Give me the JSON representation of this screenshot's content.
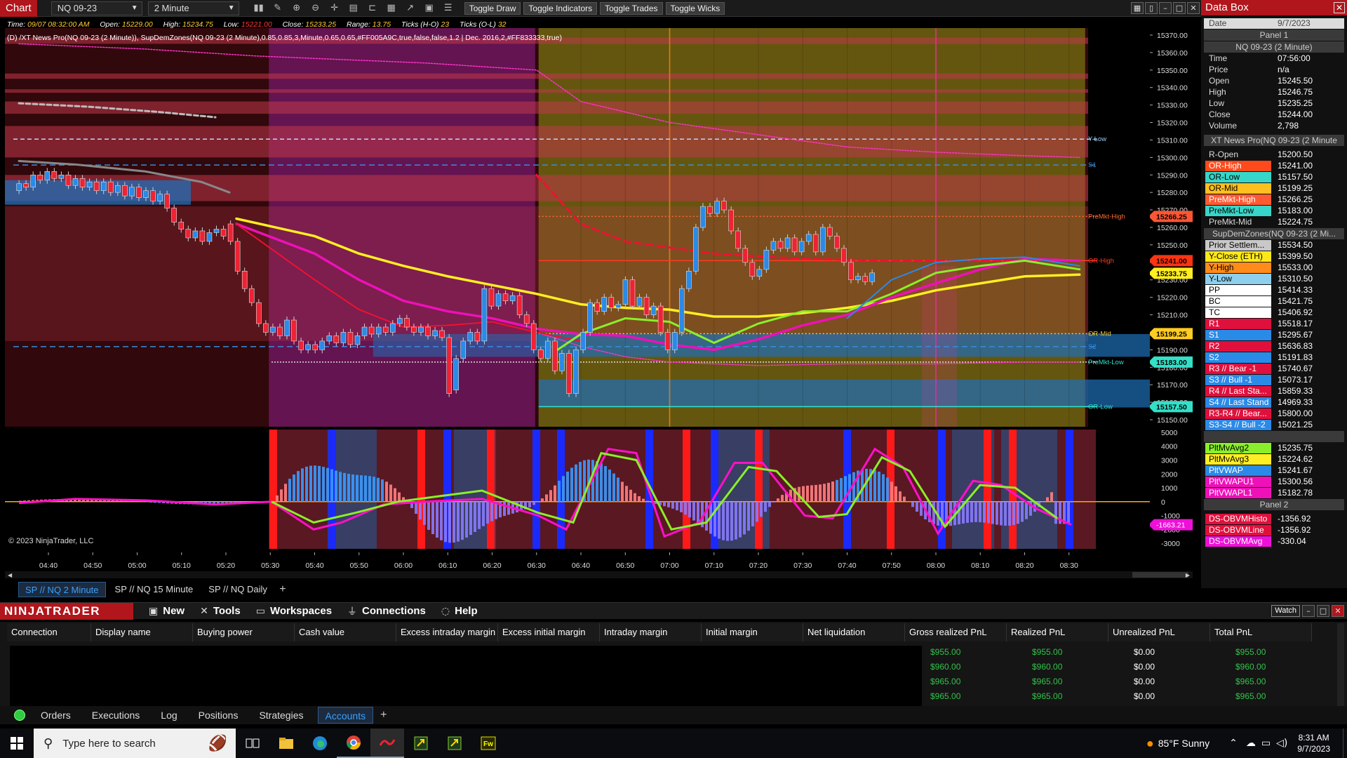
{
  "chart_window": {
    "title": "Chart",
    "instrument": "NQ 09-23",
    "interval": "2 Minute",
    "toolbar_buttons": [
      "Toggle Draw",
      "Toggle Indicators",
      "Toggle Trades",
      "Toggle Wicks"
    ],
    "toolbar_icons": [
      "bars-icon",
      "pencil-icon",
      "zoom-in-icon",
      "zoom-out-icon",
      "crosshair-icon",
      "properties-icon",
      "templates-icon",
      "instrument-overlay-icon",
      "strategy-icon",
      "data-box-icon",
      "list-icon"
    ]
  },
  "ohlc_info": {
    "time_label": "Time:",
    "time": "09/07 08:32:00 AM",
    "open_label": "Open:",
    "open": "15229.00",
    "high_label": "High:",
    "high": "15234.75",
    "low_label": "Low:",
    "low": "15221.00",
    "close_label": "Close:",
    "close": "15233.25",
    "range_label": "Range:",
    "range": "13.75",
    "ticks_ho_label": "Ticks (H-O)",
    "ticks_ho": "23",
    "ticks_ol_label": "Ticks (O-L)",
    "ticks_ol": "32"
  },
  "indicator_line": "(D) /XT News Pro(NQ 09-23 (2 Minute)), SupDemZones(NQ 09-23 (2 Minute),0.85,0.85,3,Minute,0.65,0.65,#FF005A9C,true,false,false,1.2 | Dec. 2016,2,#FF833333,true)",
  "price_axis": {
    "ticks": [
      "15370.00",
      "15360.00",
      "15350.00",
      "15340.00",
      "15330.00",
      "15320.00",
      "15310.00",
      "15300.00",
      "15290.00",
      "15280.00",
      "15270.00",
      "15260.00",
      "15250.00",
      "15240.00",
      "15230.00",
      "15220.00",
      "15210.00",
      "15200.00",
      "15190.00",
      "15180.00",
      "15170.00",
      "15160.00",
      "15150.00"
    ],
    "range": [
      15146,
      15374
    ]
  },
  "price_markers": [
    {
      "value": "15266.25",
      "price": 15266.25,
      "color": "#ff5533"
    },
    {
      "value": "15241.00",
      "price": 15241.0,
      "color": "#ff3311"
    },
    {
      "value": "15233.75",
      "price": 15233.75,
      "color": "#ffee22"
    },
    {
      "value": "15199.25",
      "price": 15199.25,
      "color": "#ffcc22"
    },
    {
      "value": "15183.00",
      "price": 15183.0,
      "color": "#33e0c8"
    },
    {
      "value": "15157.50",
      "price": 15157.5,
      "color": "#33e0c8"
    }
  ],
  "level_labels": [
    {
      "text": "Y-Low",
      "price": 15310.5,
      "color": "#99ccee"
    },
    {
      "text": "S1",
      "price": 15295.67,
      "color": "#3a8adc"
    },
    {
      "text": "PreMkt-High",
      "price": 15266.25,
      "color": "#ff6a33"
    },
    {
      "text": "OR-High",
      "price": 15241.0,
      "color": "#ff3b22"
    },
    {
      "text": "OR-Mid",
      "price": 15199.25,
      "color": "#ffcc33"
    },
    {
      "text": "S2",
      "price": 15191.83,
      "color": "#3a8adc"
    },
    {
      "text": "PreMkt-Low",
      "price": 15183.0,
      "color": "#33e0c8"
    },
    {
      "text": "OR-Low",
      "price": 15157.5,
      "color": "#33e0c8"
    }
  ],
  "osc_axis": {
    "ticks": [
      "5000",
      "4000",
      "3000",
      "2000",
      "1000",
      "0",
      "-1000",
      "-2000",
      "-3000"
    ],
    "range": [
      -3400,
      5200
    ],
    "marker": "-1663.21",
    "marker_value": -1663.21
  },
  "time_axis": [
    "04:40",
    "04:50",
    "05:00",
    "05:10",
    "05:20",
    "05:30",
    "05:40",
    "05:50",
    "06:00",
    "06:10",
    "06:20",
    "06:30",
    "06:40",
    "06:50",
    "07:00",
    "07:10",
    "07:20",
    "07:30",
    "07:40",
    "07:50",
    "08:00",
    "08:10",
    "08:20",
    "08:30"
  ],
  "copyright": "© 2023 NinjaTrader, LLC",
  "chart_tabs": [
    {
      "label": "SP // NQ  2 Minute",
      "active": true
    },
    {
      "label": "SP // NQ  15 Minute",
      "active": false
    },
    {
      "label": "SP // NQ  Daily",
      "active": false
    }
  ],
  "data_box": {
    "title": "Data Box",
    "rows": [
      {
        "label": "Date",
        "value": "9/7/2023",
        "bg": "#dcdcdc",
        "fg": "#444",
        "kind": "header"
      },
      {
        "label": "Panel 1",
        "kind": "sep"
      },
      {
        "label": "NQ 09-23 (2 Minute)",
        "kind": "sep"
      },
      {
        "label": "Time",
        "value": "07:56:00"
      },
      {
        "label": "Price",
        "value": "n/a"
      },
      {
        "label": "Open",
        "value": "15245.50"
      },
      {
        "label": "High",
        "value": "15246.75"
      },
      {
        "label": "Low",
        "value": "15235.25"
      },
      {
        "label": "Close",
        "value": "15244.00"
      },
      {
        "label": "Volume",
        "value": "2,798"
      },
      {
        "kind": "gap"
      },
      {
        "label": "XT News Pro(NQ 09-23 (2 Minute",
        "kind": "sep"
      },
      {
        "kind": "gap"
      },
      {
        "label": "R-Open",
        "value": "15200.50"
      },
      {
        "label": "OR-High",
        "value": "15241.00",
        "bg": "#ff4a1c",
        "fg": "#fff"
      },
      {
        "label": "OR-Low",
        "value": "15157.50",
        "bg": "#38d6c8",
        "fg": "#000"
      },
      {
        "label": "OR-Mid",
        "value": "15199.25",
        "bg": "#ffbf1f",
        "fg": "#000"
      },
      {
        "label": "PreMkt-High",
        "value": "15266.25",
        "bg": "#ff5a33",
        "fg": "#fff"
      },
      {
        "label": "PreMkt-Low",
        "value": "15183.00",
        "bg": "#38d6c8",
        "fg": "#000"
      },
      {
        "label": "PreMkt-Mid",
        "value": "15224.75"
      },
      {
        "label": "SupDemZones(NQ 09-23 (2 Mi...",
        "kind": "sep"
      },
      {
        "label": "Prior Settlem...",
        "value": "15534.50",
        "bg": "#c8c8c8",
        "fg": "#000"
      },
      {
        "label": "Y-Close (ETH)",
        "value": "15399.50",
        "bg": "#ffe81a",
        "fg": "#000"
      },
      {
        "label": "Y-High",
        "value": "15533.00",
        "bg": "#ff8c1a",
        "fg": "#000"
      },
      {
        "label": "Y-Low",
        "value": "15310.50",
        "bg": "#8ecfee",
        "fg": "#000"
      },
      {
        "label": "PP",
        "value": "15414.33",
        "bg": "#ffffff",
        "fg": "#000"
      },
      {
        "label": "BC",
        "value": "15421.75",
        "bg": "#ffffff",
        "fg": "#000"
      },
      {
        "label": "TC",
        "value": "15406.92",
        "bg": "#ffffff",
        "fg": "#000"
      },
      {
        "label": "R1",
        "value": "15518.17",
        "bg": "#e0103c",
        "fg": "#fff"
      },
      {
        "label": "S1",
        "value": "15295.67",
        "bg": "#2a8ae8",
        "fg": "#fff"
      },
      {
        "label": "R2",
        "value": "15636.83",
        "bg": "#e0103c",
        "fg": "#fff"
      },
      {
        "label": "S2",
        "value": "15191.83",
        "bg": "#2a8ae8",
        "fg": "#fff"
      },
      {
        "label": "R3 // Bear -1",
        "value": "15740.67",
        "bg": "#e0103c",
        "fg": "#fff"
      },
      {
        "label": "S3 // Bull -1",
        "value": "15073.17",
        "bg": "#2a8ae8",
        "fg": "#fff"
      },
      {
        "label": "R4 // Last Sta...",
        "value": "15859.33",
        "bg": "#e0103c",
        "fg": "#fff"
      },
      {
        "label": "S4 // Last Stand",
        "value": "14969.33",
        "bg": "#2a8ae8",
        "fg": "#fff"
      },
      {
        "label": "R3-R4 // Bear...",
        "value": "15800.00",
        "bg": "#e0103c",
        "fg": "#fff"
      },
      {
        "label": "S3-S4 // Bull -2",
        "value": "15021.25",
        "bg": "#2a8ae8",
        "fg": "#fff"
      },
      {
        "kind": "sep",
        "label": ""
      },
      {
        "label": "PltMvAvg2",
        "value": "15235.75",
        "bg": "#8aef2a",
        "fg": "#000"
      },
      {
        "label": "PltMvAvg3",
        "value": "15224.62",
        "bg": "#ffee22",
        "fg": "#000"
      },
      {
        "label": "PltVWAP",
        "value": "15241.67",
        "bg": "#2a8ae8",
        "fg": "#fff"
      },
      {
        "label": "PltVWAPU1",
        "value": "15300.56",
        "bg": "#ee10b8",
        "fg": "#fff"
      },
      {
        "label": "PltVWAPL1",
        "value": "15182.78",
        "bg": "#ee10b8",
        "fg": "#fff"
      },
      {
        "label": "Panel 2",
        "kind": "sep"
      },
      {
        "kind": "gap"
      },
      {
        "label": "DS-OBVMHisto",
        "value": "-1356.92",
        "bg": "#e0103c",
        "fg": "#fff"
      },
      {
        "label": "DS-OBVMLine",
        "value": "-1356.92",
        "bg": "#e0103c",
        "fg": "#fff"
      },
      {
        "label": "DS-OBVMAvg",
        "value": "-330.04",
        "bg": "#ee10d8",
        "fg": "#fff"
      }
    ]
  },
  "control_center": {
    "logo": "NINJATRADER",
    "menus": [
      {
        "label": "New",
        "icon": "new-window-icon",
        "glyph": "▣"
      },
      {
        "label": "Tools",
        "icon": "tools-icon",
        "glyph": "✕"
      },
      {
        "label": "Workspaces",
        "icon": "workspaces-icon",
        "glyph": "▭"
      },
      {
        "label": "Connections",
        "icon": "connections-icon",
        "glyph": "⏚"
      },
      {
        "label": "Help",
        "icon": "help-icon",
        "glyph": "◌"
      }
    ],
    "watch_label": "Watch"
  },
  "accounts_grid": {
    "columns": [
      "Connection",
      "Display name",
      "Buying power",
      "Cash value",
      "Excess intraday margin",
      "Excess initial margin",
      "Intraday margin",
      "Initial margin",
      "Net liquidation",
      "Gross realized PnL",
      "Realized PnL",
      "Unrealized PnL",
      "Total PnL"
    ],
    "rows": [
      [
        "$955.00",
        "$955.00",
        "$0.00",
        "$955.00"
      ],
      [
        "$960.00",
        "$960.00",
        "$0.00",
        "$960.00"
      ],
      [
        "$965.00",
        "$965.00",
        "$0.00",
        "$965.00"
      ],
      [
        "$965.00",
        "$965.00",
        "$0.00",
        "$965.00"
      ]
    ]
  },
  "bottom_tabs": [
    {
      "label": "Orders",
      "active": false
    },
    {
      "label": "Executions",
      "active": false
    },
    {
      "label": "Log",
      "active": false
    },
    {
      "label": "Positions",
      "active": false
    },
    {
      "label": "Strategies",
      "active": false
    },
    {
      "label": "Accounts",
      "active": true
    }
  ],
  "taskbar": {
    "search_placeholder": "Type here to search",
    "weather": "85°F  Sunny",
    "time": "8:31 AM",
    "date": "9/7/2023"
  },
  "colors": {
    "brand": "#b0161c",
    "accent": "#39a0ff",
    "profit": "#33c24a"
  }
}
